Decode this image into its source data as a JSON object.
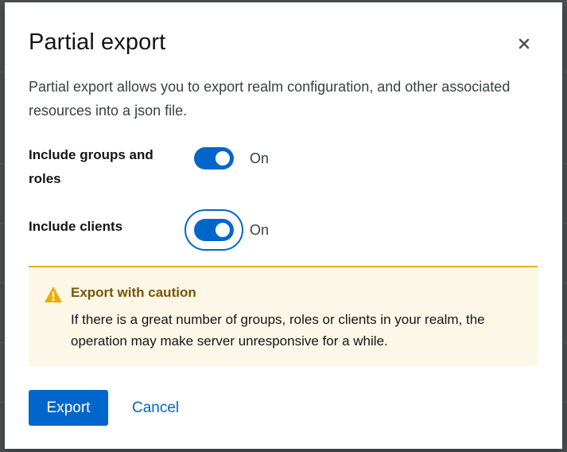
{
  "modal": {
    "title": "Partial export",
    "close_icon": "close-icon",
    "description": "Partial export allows you to export realm configuration, and other associated resources into a json file."
  },
  "options": [
    {
      "label": "Include groups and roles",
      "state": "On",
      "checked": true
    },
    {
      "label": "Include clients",
      "state": "On",
      "checked": true
    }
  ],
  "alert": {
    "icon": "warning-icon",
    "title": "Export with caution",
    "body": "If there is a great number of groups, roles or clients in your realm, the operation may make server unresponsive for a while."
  },
  "footer": {
    "export_label": "Export",
    "cancel_label": "Cancel"
  },
  "colors": {
    "primary": "#0066cc",
    "warning": "#f0ab00",
    "warning_title": "#795600",
    "alert_bg": "#fdf7e7"
  }
}
